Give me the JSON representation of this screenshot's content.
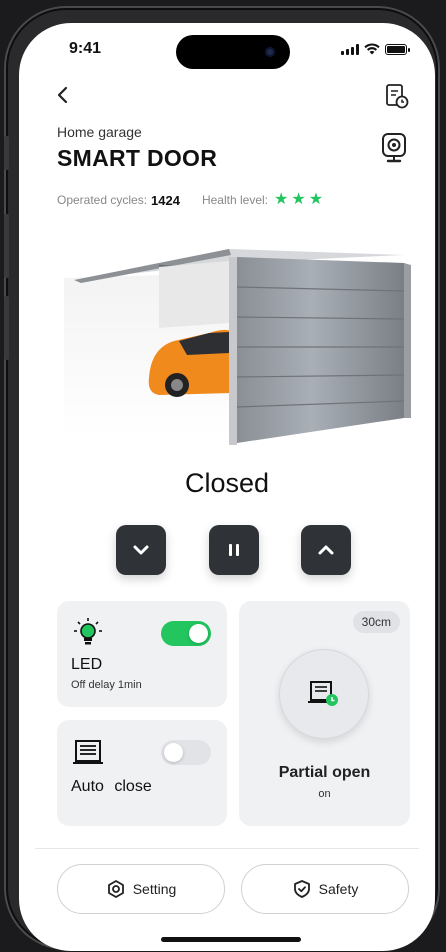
{
  "status_bar": {
    "time": "9:41"
  },
  "header": {
    "subtitle": "Home garage",
    "title": "SMART DOOR",
    "back_icon": "chevron-left-icon",
    "history_icon": "document-clock-icon",
    "camera_icon": "camera-icon"
  },
  "meta": {
    "cycles_label": "Operated cycles:",
    "cycles_value": "1424",
    "health_label": "Health level:",
    "health_stars": 3
  },
  "door": {
    "state": "Closed"
  },
  "controls": {
    "down_icon": "chevron-down-icon",
    "pause_icon": "pause-icon",
    "up_icon": "chevron-up-icon"
  },
  "led_card": {
    "title": "LED",
    "subtitle": "Off delay 1min",
    "enabled": true,
    "icon": "bulb-icon"
  },
  "auto_close_card": {
    "title": "Auto close",
    "enabled": false,
    "icon": "garage-gate-icon"
  },
  "partial_card": {
    "distance": "30cm",
    "title": "Partial open",
    "status": "on",
    "icon": "garage-timer-icon"
  },
  "bottom": {
    "setting_label": "Setting",
    "safety_label": "Safety"
  },
  "colors": {
    "accent_green": "#22c55e",
    "control_dark": "#2f3237",
    "card_bg": "#f0f1f3",
    "car_orange": "#f08a1c"
  }
}
